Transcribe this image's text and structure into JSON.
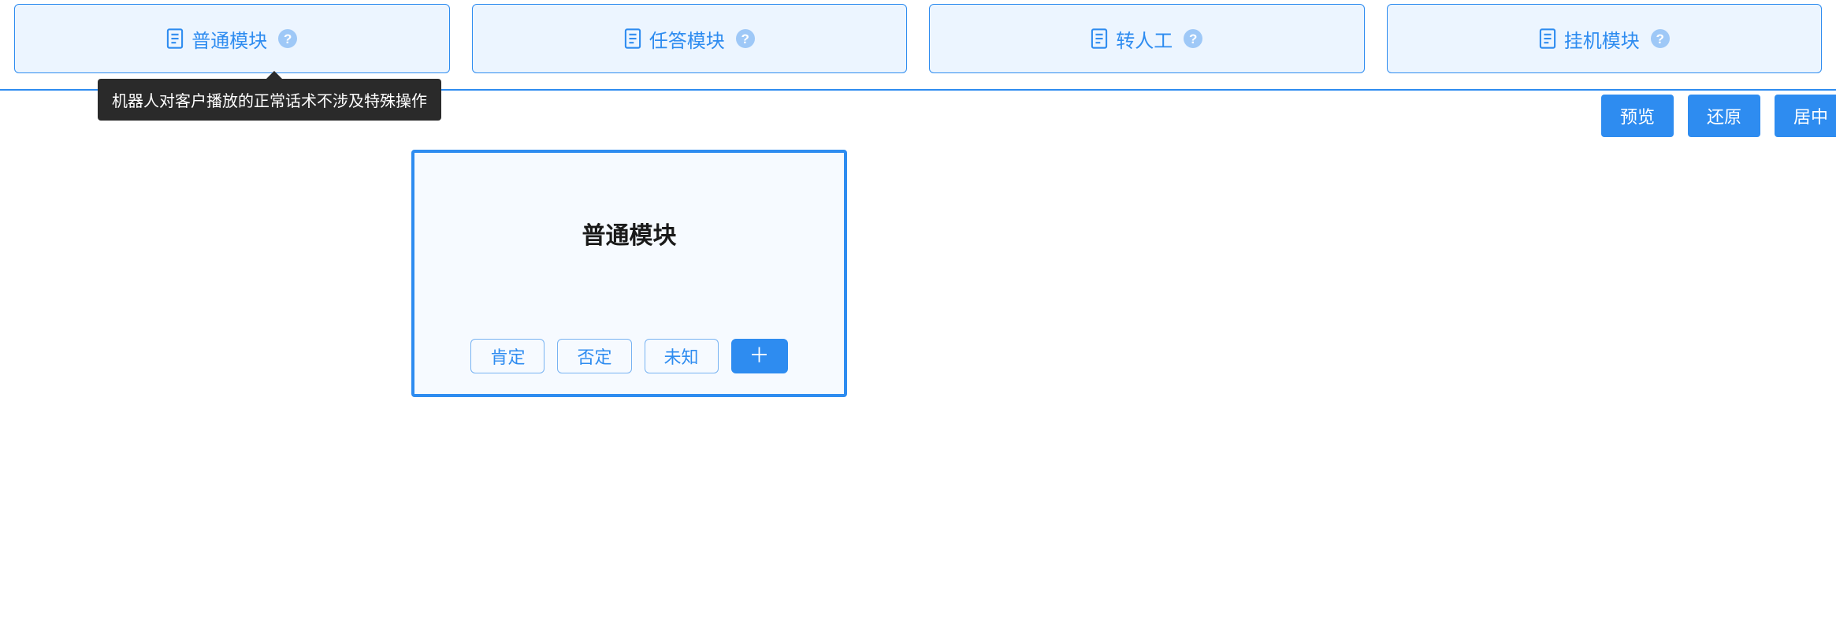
{
  "tabs": [
    {
      "label": "普通模块"
    },
    {
      "label": "任答模块"
    },
    {
      "label": "转人工"
    },
    {
      "label": "挂机模块"
    }
  ],
  "tooltip": "机器人对客户播放的正常话术不涉及特殊操作",
  "actions": {
    "preview": "预览",
    "restore": "还原",
    "center": "居中"
  },
  "node": {
    "title": "普通模块",
    "tags": [
      "肯定",
      "否定",
      "未知"
    ],
    "add": "＋"
  }
}
